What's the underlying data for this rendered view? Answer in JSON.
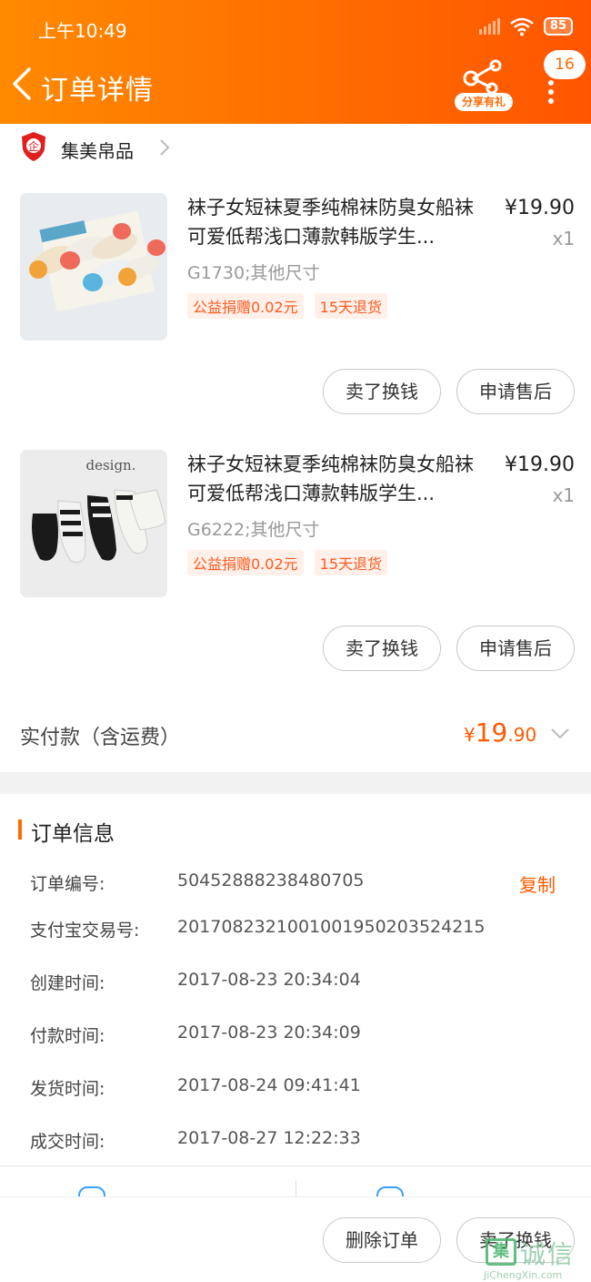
{
  "status_bar": {
    "time": "上午10:49",
    "battery": "85"
  },
  "header": {
    "title": "订单详情",
    "share_label": "分享有礼",
    "badge_count": "16"
  },
  "store": {
    "name": "集美帛品",
    "logo_text": "企"
  },
  "items": [
    {
      "title": "袜子女短袜夏季纯棉袜防臭女船袜可爱低帮浅口薄款韩版学生...",
      "price": "¥19.90",
      "quantity": "x1",
      "sku": "G1730;其他尺寸",
      "tags": [
        "公益捐赠0.02元",
        "15天退货"
      ],
      "buttons": {
        "sell": "卖了换钱",
        "after_sale": "申请售后"
      }
    },
    {
      "title": "袜子女短袜夏季纯棉袜防臭女船袜可爱低帮浅口薄款韩版学生...",
      "price": "¥19.90",
      "quantity": "x1",
      "sku": "G6222;其他尺寸",
      "tags": [
        "公益捐赠0.02元",
        "15天退货"
      ],
      "buttons": {
        "sell": "卖了换钱",
        "after_sale": "申请售后"
      },
      "image_text": "design."
    }
  ],
  "total": {
    "label": "实付款（含运费）",
    "currency": "¥",
    "integer": "19",
    "decimal": ".90"
  },
  "order_info": {
    "title": "订单信息",
    "copy_label": "复制",
    "rows": [
      {
        "key": "订单编号:",
        "value": "50452888238480705"
      },
      {
        "key": "支付宝交易号:",
        "value": "2017082321001001950203524215"
      },
      {
        "key": "创建时间:",
        "value": "2017-08-23 20:34:04"
      },
      {
        "key": "付款时间:",
        "value": "2017-08-23 20:34:09"
      },
      {
        "key": "发货时间:",
        "value": "2017-08-24 09:41:41"
      },
      {
        "key": "成交时间:",
        "value": "2017-08-27 12:22:33"
      }
    ]
  },
  "bottom_bar": {
    "delete_label": "删除订单",
    "sell_label": "卖了换钱"
  },
  "watermark": {
    "box": "集",
    "text": "诚信",
    "url": "JiChengXin.com"
  },
  "colors": {
    "accent": "#ff6a00",
    "price": "#ff5a00"
  }
}
